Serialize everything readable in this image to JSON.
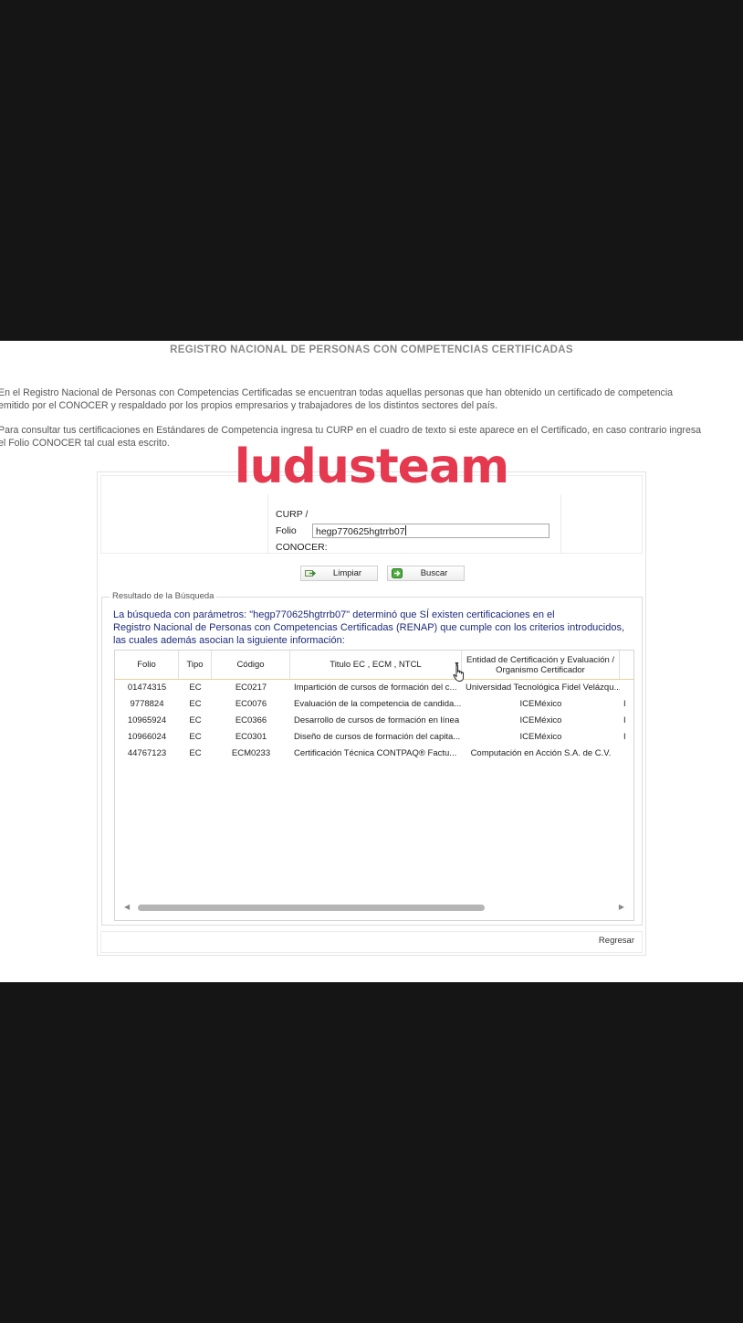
{
  "page": {
    "title": "REGISTRO NACIONAL DE PERSONAS CON COMPETENCIAS CERTIFICADAS",
    "intro_lines": [
      "En el Registro Nacional de Personas con Competencias Certificadas se encuentran todas aquellas personas que han obtenido un certificado de competencia",
      "emitido por el CONOCER y respaldado por los propios empresarios y trabajadores de los distintos sectores del país."
    ],
    "instructions_lines": [
      "Para consultar tus certificaciones en Estándares de Competencia ingresa tu CURP en el cuadro de texto si este aparece en el Certificado, en caso contrario ingresa",
      "el Folio CONOCER tal cual esta escrito."
    ],
    "watermark": "ludusteam"
  },
  "form": {
    "label_line1": "CURP /",
    "label_line2": "Folio",
    "label_line3": "CONOCER:",
    "input_value": "hegp770625hgtrrb07",
    "clear_button": "Limpiar",
    "search_button": "Buscar"
  },
  "results": {
    "legend": "Resultado de la Búsqueda",
    "message_lines": [
      "La búsqueda con parámetros: \"hegp770625hgtrrb07\" determinó que SÍ existen certificaciones en el",
      "Registro Nacional de Personas con Competencias Certificadas (RENAP) que cumple con los criterios introducidos,",
      "las cuales además asocian la siguiente información:"
    ],
    "columns": {
      "folio": "Folio",
      "tipo": "Tipo",
      "codigo": "Código",
      "titulo": "Titulo EC , ECM , NTCL",
      "entidad_line1": "Entidad de Certificación y Evaluación /",
      "entidad_line2": "Organismo Certificador"
    },
    "rows": [
      {
        "folio": "01474315",
        "tipo": "EC",
        "codigo": "EC0217",
        "titulo": "Impartición de cursos de formación del c...",
        "entidad": "Universidad Tecnológica Fidel Velázqu...",
        "extra": ""
      },
      {
        "folio": "9778824",
        "tipo": "EC",
        "codigo": "EC0076",
        "titulo": "Evaluación de la competencia de candida...",
        "entidad": "ICEMéxico",
        "extra": "I"
      },
      {
        "folio": "10965924",
        "tipo": "EC",
        "codigo": "EC0366",
        "titulo": "Desarrollo de cursos de formación en línea",
        "entidad": "ICEMéxico",
        "extra": "I"
      },
      {
        "folio": "10966024",
        "tipo": "EC",
        "codigo": "EC0301",
        "titulo": "Diseño de cursos de formación del capita...",
        "entidad": "ICEMéxico",
        "extra": "I"
      },
      {
        "folio": "44767123",
        "tipo": "EC",
        "codigo": "ECM0233",
        "titulo": "Certificación Técnica CONTPAQ® Factu...",
        "entidad": "Computación en Acción S.A. de C.V.",
        "extra": ""
      }
    ],
    "back_button": "Regresar"
  },
  "colors": {
    "background": "#151515",
    "watermark": "#e4394f",
    "message_text": "#1e2a7a"
  }
}
